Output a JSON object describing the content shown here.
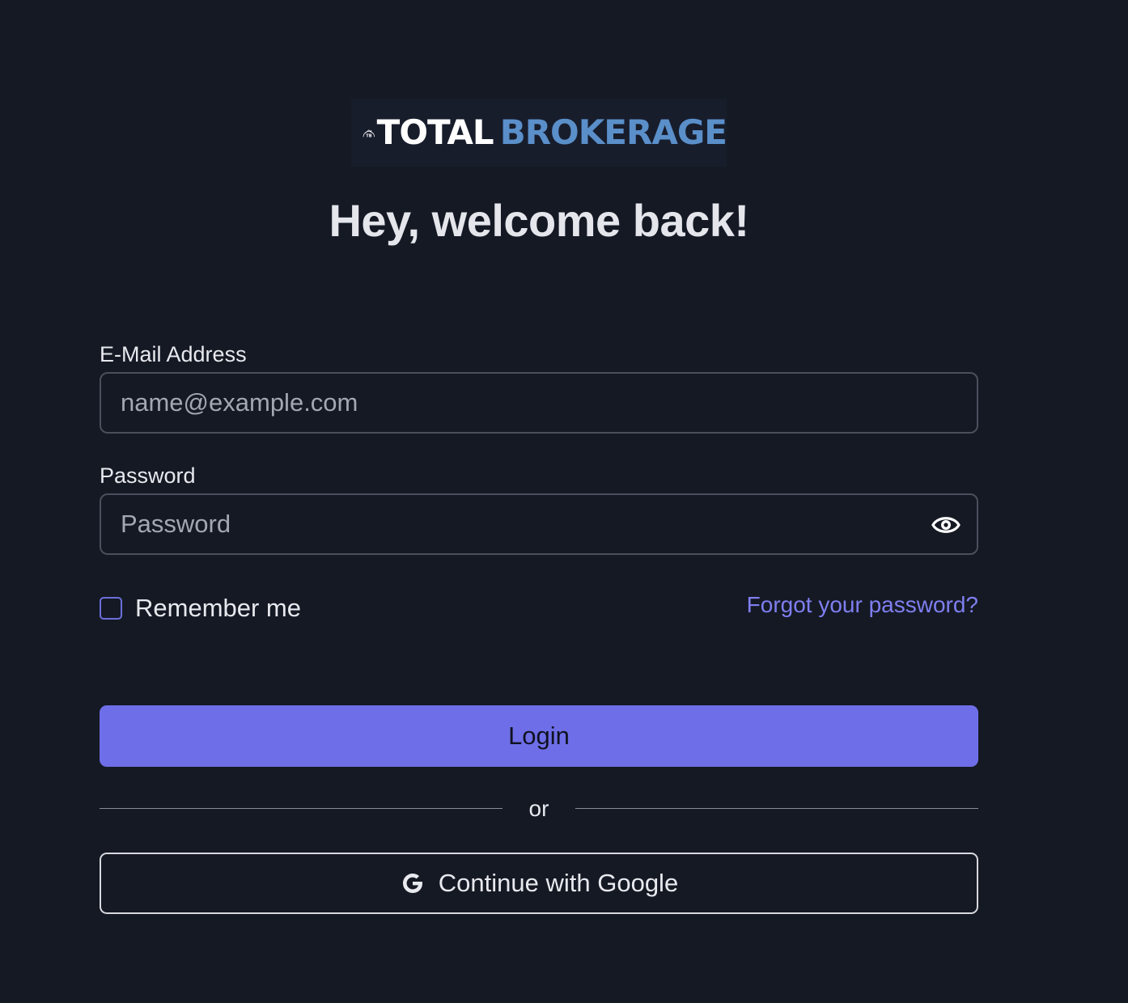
{
  "logo": {
    "mark_letters": "TB",
    "word1": "TOTAL",
    "word2": "BROKERAGE",
    "colors": {
      "word1": "#ffffff",
      "word2": "#5a8fc9"
    }
  },
  "heading": "Hey, welcome back!",
  "email": {
    "label": "E-Mail Address",
    "placeholder": "name@example.com",
    "value": ""
  },
  "password": {
    "label": "Password",
    "placeholder": "Password",
    "value": "",
    "toggle_icon": "eye-icon"
  },
  "remember": {
    "label": "Remember me",
    "checked": false
  },
  "forgot_link": "Forgot your password?",
  "login_button": "Login",
  "divider_text": "or",
  "google_button": {
    "label": "Continue with Google",
    "icon": "google-icon"
  },
  "colors": {
    "background": "#151924",
    "accent": "#6e6ee8",
    "link": "#7f7ff0"
  }
}
